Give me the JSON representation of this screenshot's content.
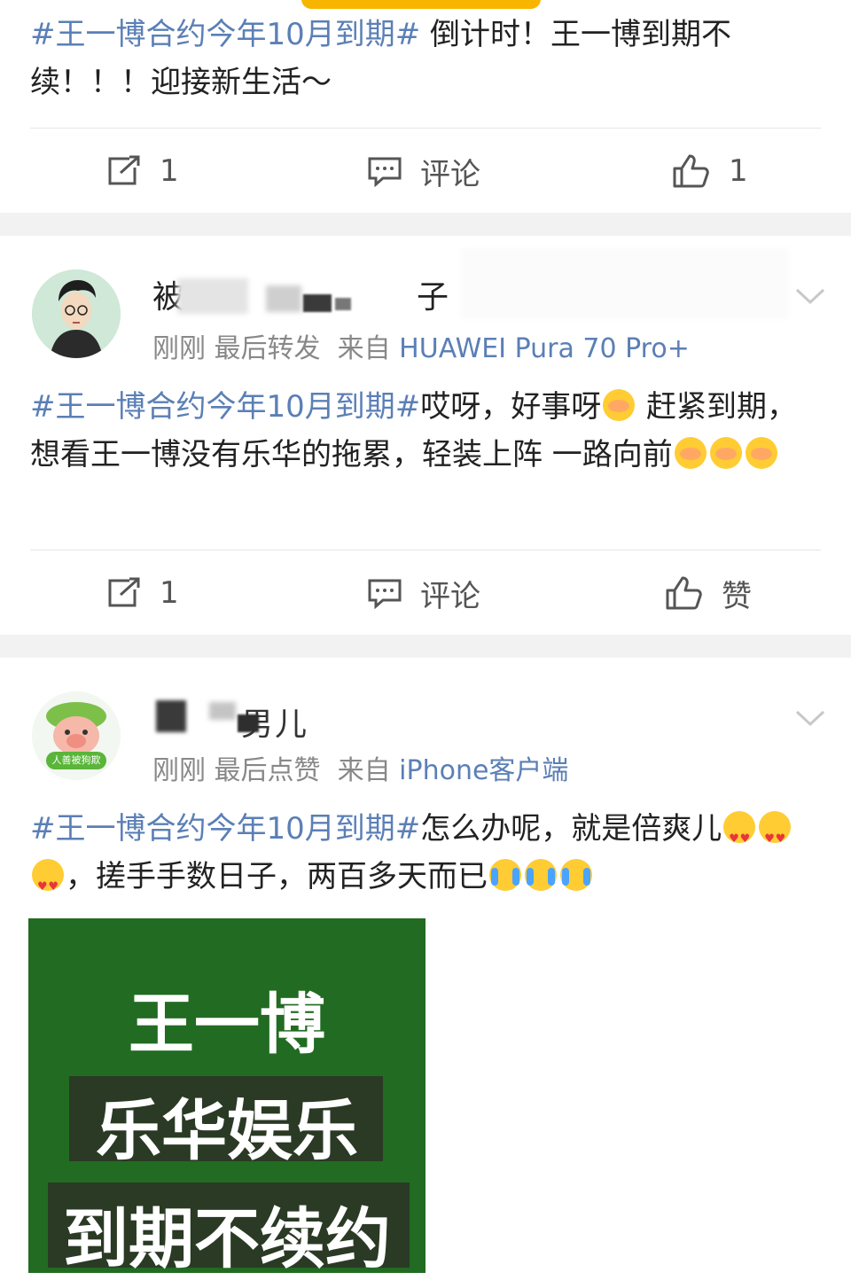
{
  "posts": [
    {
      "text_tag": "#王一博合约今年10月到期#",
      "text_body": " 倒计时！王一博到期不续！！！迎接新生活～",
      "actions": {
        "repost": "1",
        "comment": "评论",
        "like": "1"
      }
    },
    {
      "user": {
        "name_left": "被",
        "name_right": "子"
      },
      "meta": {
        "time": "刚刚",
        "action": "最后转发",
        "from_label": "来自",
        "source": "HUAWEI Pura 70 Pro+"
      },
      "text_tag": "#王一博合约今年10月到期#",
      "text_part1": "哎呀，好事呀",
      "text_part2": " 赶紧到期，想看王一博没有乐华的拖累，轻装上阵 一路向前",
      "actions": {
        "repost": "1",
        "comment": "评论",
        "like": "赞"
      }
    },
    {
      "user": {
        "name_visible": "男儿",
        "avatar_caption": "人善被狗欺"
      },
      "meta": {
        "time": "刚刚",
        "action": "最后点赞",
        "from_label": "来自",
        "source": "iPhone客户端"
      },
      "text_tag": "#王一博合约今年10月到期#",
      "text_part1": "怎么办呢，就是倍爽儿",
      "text_part2": "，搓手手数日子，两百多天而已",
      "image_lines": [
        "王一博",
        "乐华娱乐",
        "到期不续约"
      ]
    }
  ],
  "colors": {
    "link": "#5b7fb6",
    "image_bg": "#226b22"
  }
}
